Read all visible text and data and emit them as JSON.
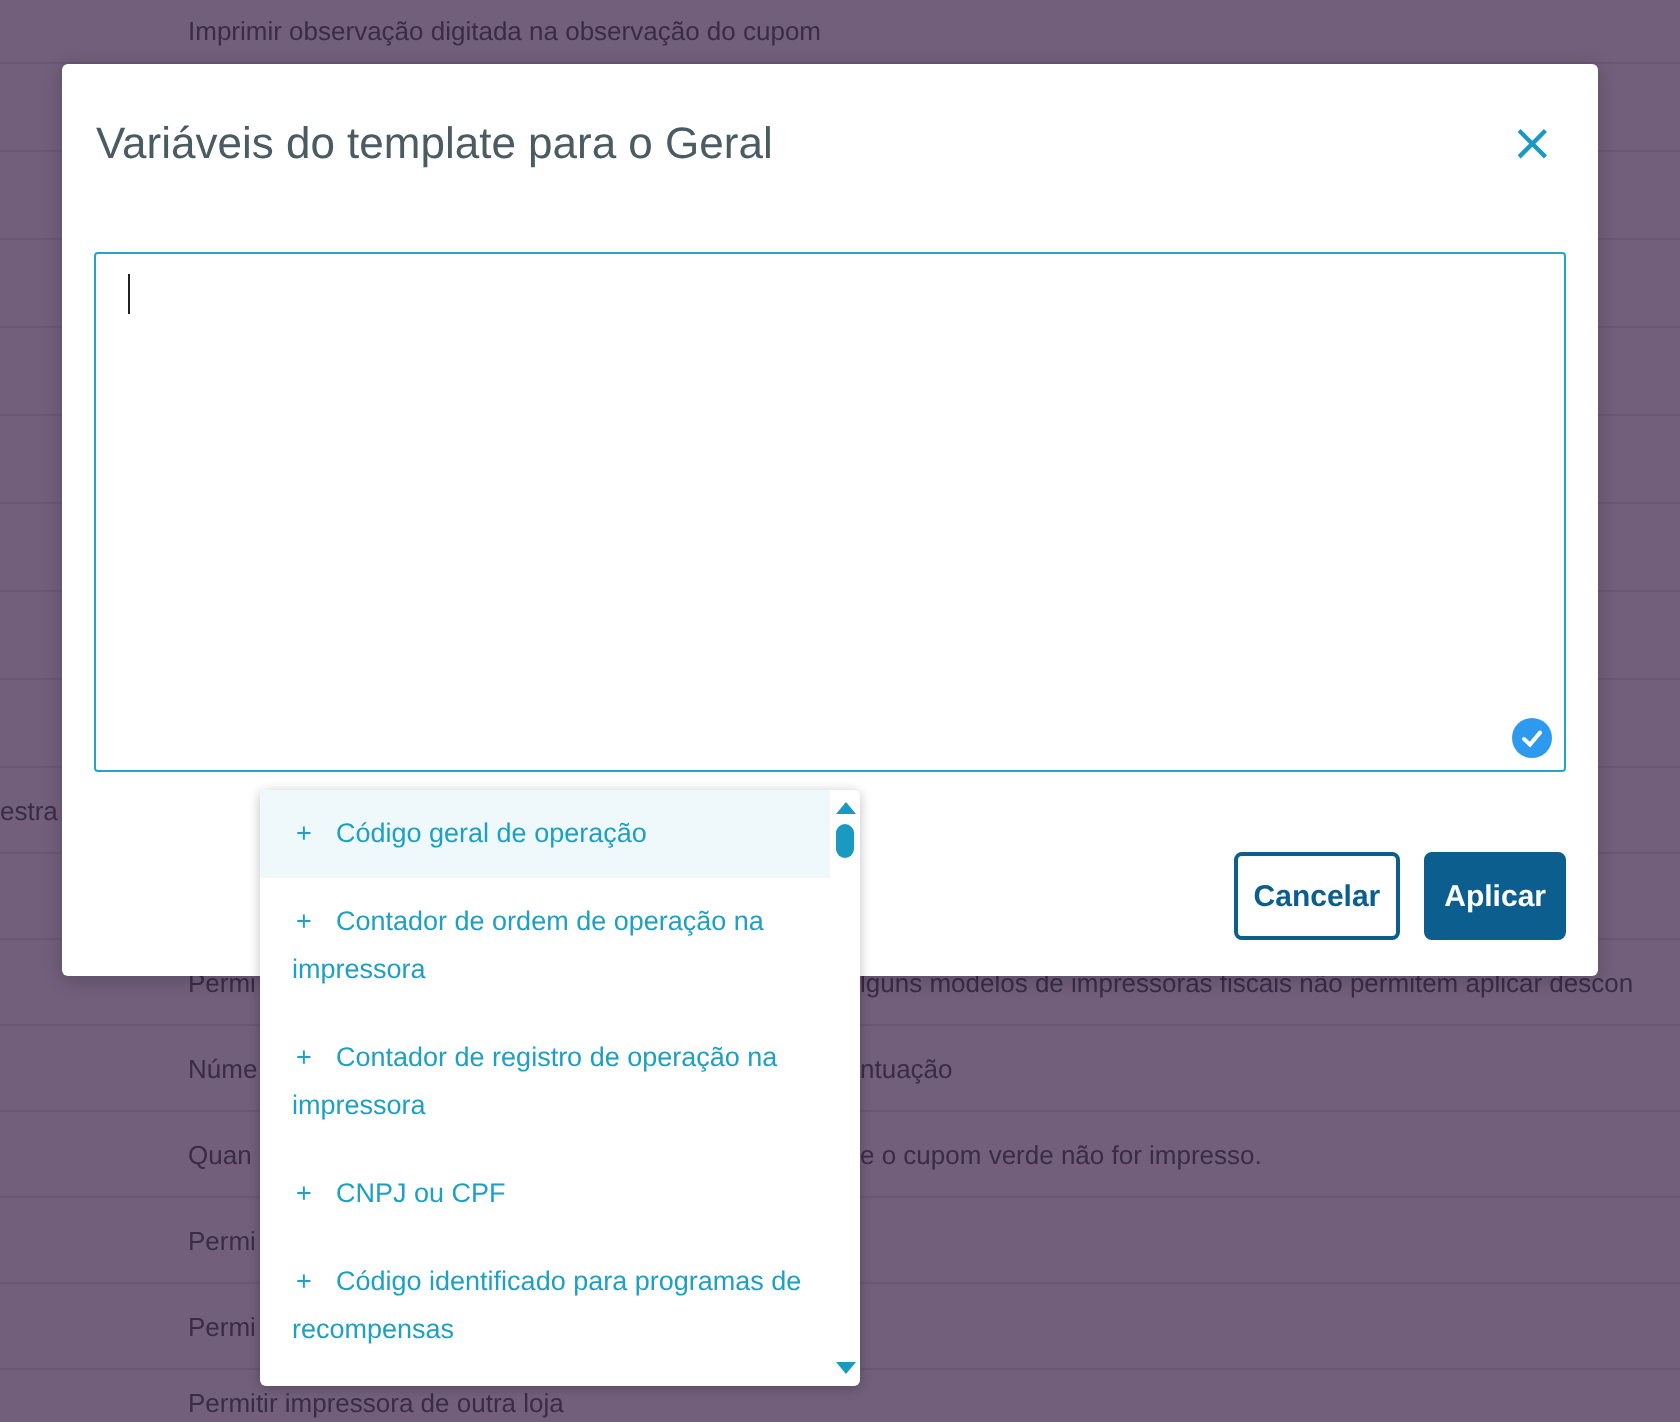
{
  "background": {
    "top_row": "Imprimir observação digitada na observação do cupom",
    "rows": [
      {},
      {},
      {},
      {},
      {},
      {},
      {},
      {},
      {
        "side": "estra"
      },
      {},
      {
        "text": "Permi",
        "continuation": "lguns modelos de impressoras fiscais não permitem aplicar descon"
      },
      {
        "text": "Núme",
        "continuation": "ntuação"
      },
      {
        "text": "Quan",
        "continuation": "e o cupom verde não for impresso."
      },
      {
        "text": "Permi"
      },
      {
        "text": "Permi"
      },
      {
        "text": "Permitir impressora de outra loja"
      }
    ]
  },
  "dialog": {
    "title": "Variáveis do template para o Geral",
    "close": "×",
    "editor": {
      "focused": true,
      "valid": true
    },
    "buttons": [
      {
        "kind": "secondary",
        "label": "Cancelar"
      },
      {
        "kind": "primary",
        "label": "Aplicar"
      }
    ]
  },
  "suggestions": {
    "items": [
      {
        "icon": "+",
        "label": "Código geral de operação",
        "highlighted": true
      },
      {
        "icon": "+",
        "label": "Contador de ordem de operação na impressora",
        "highlighted": false
      },
      {
        "icon": "+",
        "label": "Contador de registro de operação na impressora",
        "highlighted": false
      },
      {
        "icon": "+",
        "label": "CNPJ ou CPF",
        "highlighted": false
      },
      {
        "icon": "+",
        "label": "Código identificado para programas de recompensas",
        "highlighted": false
      }
    ]
  }
}
